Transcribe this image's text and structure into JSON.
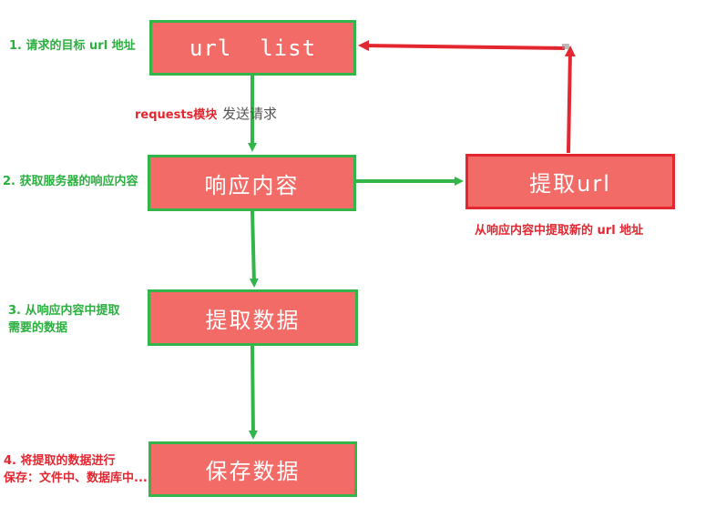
{
  "boxes": {
    "url_list": "url  list",
    "response": "响应内容",
    "extract_data": "提取数据",
    "save_data": "保存数据",
    "extract_url": "提取url"
  },
  "notes": {
    "step1": "1. 请求的目标 url 地址",
    "requests_module": "requests模块",
    "send_request": "发送请求",
    "step2": "2. 获取服务器的响应内容",
    "extract_new_url": "从响应内容中提取新的 url 地址",
    "step3_line1": "3. 从响应内容中提取",
    "step3_line2": "需要的数据",
    "step4_line1": "4. 将提取的数据进行",
    "step4_line2": "保存：文件中、数据库中..."
  },
  "colors": {
    "box_fill": "#f26b66",
    "green": "#33b54a",
    "red": "#e3262f"
  }
}
